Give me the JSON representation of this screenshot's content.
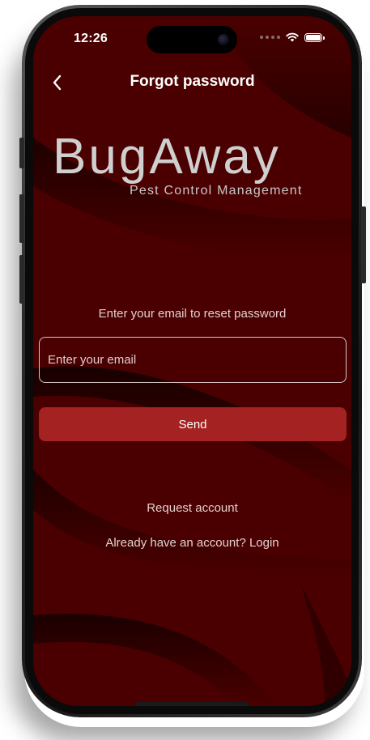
{
  "status_bar": {
    "time": "12:26",
    "icons": [
      "signal-dots-icon",
      "wifi-icon",
      "battery-icon"
    ]
  },
  "nav": {
    "back_icon": "chevron-left-icon",
    "title": "Forgot password"
  },
  "logo": {
    "brand": "BugAway",
    "tagline": "Pest Control Management"
  },
  "form": {
    "instruction": "Enter your email to reset password",
    "email_value": "",
    "email_placeholder": "Enter your email",
    "send_label": "Send"
  },
  "links": {
    "request_account": "Request account",
    "login": "Already have an account? Login"
  },
  "colors": {
    "background": "#4a0000",
    "button": "#a52222",
    "text": "#ffffff"
  }
}
